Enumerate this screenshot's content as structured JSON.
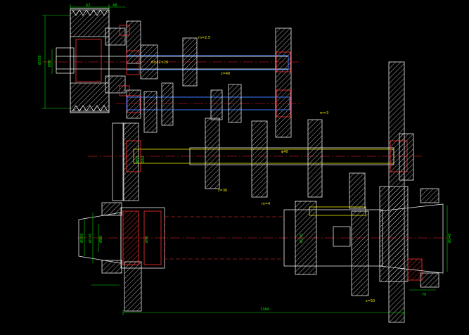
{
  "drawing": {
    "top_dims": [
      "62",
      "48"
    ],
    "left_dims": [
      "Ø358",
      "Ø90"
    ],
    "bottom_dim": "1384",
    "right_dims": [
      "Ø140",
      "70"
    ],
    "spindle_dims": [
      "Ø150",
      "Ø130",
      "Ø80",
      "Ø90",
      "Ø120"
    ],
    "shaft_dims": [
      "Ø40",
      "Ø50"
    ],
    "small_labels": [
      "6×22×26",
      "m=2.5",
      "z=40",
      "φ40",
      "m=3",
      "z=36",
      "m=4",
      "z=50"
    ],
    "colors": {
      "background": "#000000",
      "outline": "#e8e8e8",
      "section_hatch": "#e8e8e8",
      "centerline": "#ff2020",
      "dimension": "#00e000",
      "shaft_highlight": "#3a7aff",
      "labels": "#e8e800",
      "bearing": "#ff3030"
    }
  }
}
